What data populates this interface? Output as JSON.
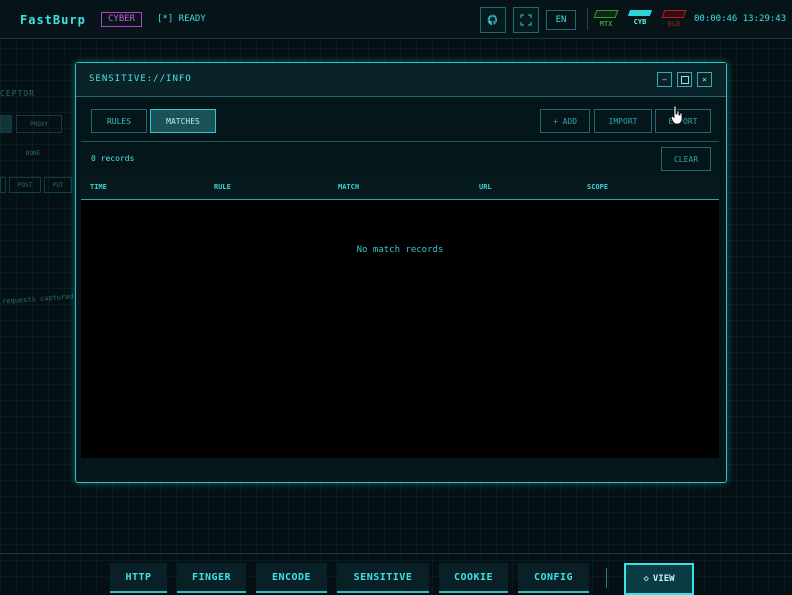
{
  "app": {
    "name": "FastBurp",
    "mode_badge": "CYBER",
    "status": "[*] READY",
    "lang": "EN",
    "themes": [
      {
        "label": "MTX",
        "color": "#3a9a3a"
      },
      {
        "label": "CYB",
        "color": "#2fd3d8"
      },
      {
        "label": "BLD",
        "color": "#a0262a"
      }
    ],
    "clock": "00:00:46 13:29:43",
    "icons": [
      "github-icon",
      "fullscreen-icon"
    ]
  },
  "background_panel": {
    "title": "CEPTOR",
    "chips": [
      "PROXY",
      "DONE",
      "POST",
      "PUT"
    ],
    "empty_text": "requests captured"
  },
  "modal": {
    "title": "SENSITIVE://INFO",
    "tabs": [
      {
        "label": "RULES",
        "active": false
      },
      {
        "label": "MATCHES",
        "active": true
      }
    ],
    "actions": [
      "+ ADD",
      "IMPORT",
      "EXPORT"
    ],
    "records_text": "0 records",
    "clear_label": "CLEAR",
    "columns": [
      "TIME",
      "RULE",
      "MATCH",
      "URL",
      "SCOPE"
    ],
    "empty_message": "No match records"
  },
  "dock": {
    "items": [
      "HTTP",
      "FINGER",
      "ENCODE",
      "SENSITIVE",
      "COOKIE",
      "CONFIG"
    ],
    "view_label": "VIEW"
  },
  "colors": {
    "accent": "#2fd3d8",
    "magenta": "#c95fe0",
    "background": "#051014"
  }
}
